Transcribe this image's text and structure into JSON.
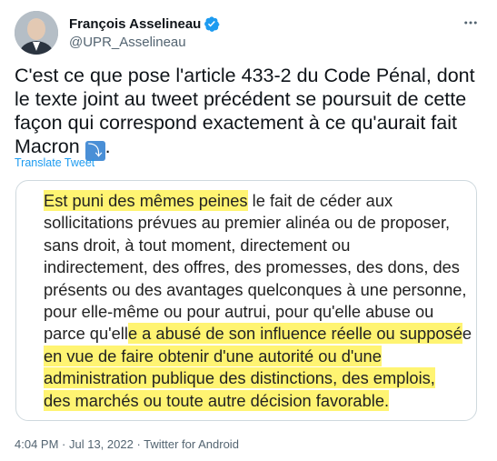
{
  "author": {
    "name": "François Asselineau",
    "handle": "@UPR_Asselineau"
  },
  "tweet": {
    "text_main": "C'est ce que pose l'article 433-2 du Code Pénal, dont le texte joint au tweet précédent se poursuit de cette façon qui correspond exactement à ce qu'aurait fait Macron ",
    "emoji": "⤵",
    "text_end": ".",
    "translate_label": "Translate Tweet"
  },
  "image_text": {
    "line1_hl": "Est puni des mêmes peines",
    "line1_rest": " le fait de céder aux",
    "line2": "sollicitations prévues au premier alinéa ou de proposer,",
    "line3": "sans droit, à tout moment, directement ou",
    "line4": "indirectement, des offres, des promesses, des dons, des",
    "line5": "présents ou des avantages quelconques à une personne,",
    "line6": "pour elle-même ou pour autrui, pour qu'elle abuse ou",
    "line7_a": "parce qu'ell",
    "line7_hl": "e a abusé de son influence réelle ou supposé",
    "line7_b": "e",
    "line8": "en vue de faire obtenir d'une autorité ou d'une",
    "line9": "administration publique des distinctions, des emplois,",
    "line10": "des marchés ou toute autre décision favorable."
  },
  "footer": {
    "time": "4:04 PM",
    "sep1": " · ",
    "date": "Jul 13, 2022",
    "sep2": " · ",
    "source": "Twitter for Android"
  },
  "colors": {
    "link": "#1d9bf0",
    "secondary": "#536471",
    "highlight": "#fff03c",
    "verified": "#1d9bf0"
  }
}
